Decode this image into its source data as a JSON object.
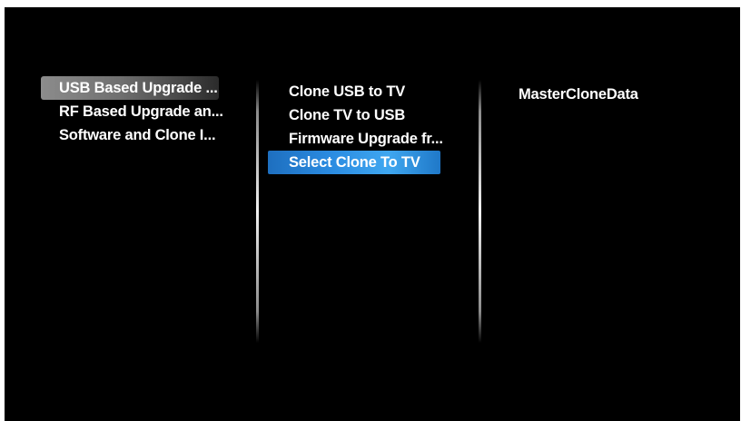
{
  "menu_level_1": {
    "items": [
      {
        "label": "USB Based Upgrade ...",
        "state": "path"
      },
      {
        "label": "RF Based Upgrade an...",
        "state": "normal"
      },
      {
        "label": "Software and Clone I...",
        "state": "normal"
      }
    ]
  },
  "menu_level_2": {
    "items": [
      {
        "label": "Clone USB to TV",
        "state": "normal"
      },
      {
        "label": "Clone TV to USB",
        "state": "normal"
      },
      {
        "label": "Firmware Upgrade fr...",
        "state": "normal"
      },
      {
        "label": "Select Clone To TV",
        "state": "focused"
      }
    ]
  },
  "menu_level_3": {
    "items": [
      {
        "label": "MasterCloneData",
        "state": "normal"
      }
    ]
  },
  "colors": {
    "background": "#000000",
    "focus_highlight": "#2a8ae0",
    "path_highlight": "#7a7a7a",
    "text": "#ffffff"
  }
}
